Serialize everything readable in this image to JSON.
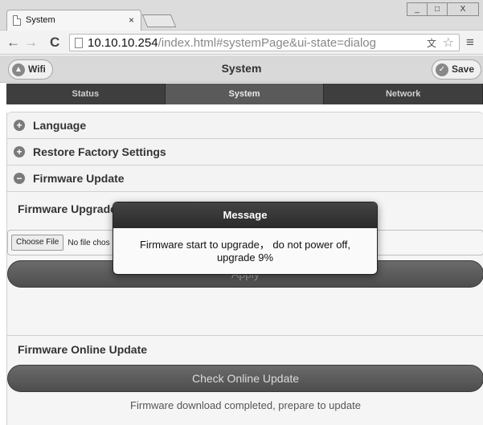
{
  "browser": {
    "tab_title": "System",
    "tab_close": "×",
    "url_host": "10.10.10.254",
    "url_path": "/index.html#systemPage&ui-state=dialog",
    "window_buttons": [
      "_",
      "□",
      "X"
    ],
    "icons": [
      "back-arrow-icon",
      "forward-arrow-icon",
      "reload-icon",
      "page-icon",
      "translate-icon",
      "star-icon",
      "menu-icon"
    ]
  },
  "header": {
    "title": "System",
    "wifi_label": "Wifi",
    "save_label": "Save"
  },
  "nav": {
    "tabs": [
      {
        "label": "Status"
      },
      {
        "label": "System"
      },
      {
        "label": "Network"
      }
    ],
    "active": "System"
  },
  "sections": [
    {
      "label": "Language",
      "state": "collapsed"
    },
    {
      "label": "Restore Factory Settings",
      "state": "collapsed"
    },
    {
      "label": "Firmware Update",
      "state": "expanded"
    }
  ],
  "firmware": {
    "upgrade_label": "Firmware Upgrade",
    "choose_file_label": "Choose File",
    "file_status": "No file chos",
    "apply_label": "Apply",
    "online_update_label": "Firmware Online Update",
    "check_online_label": "Check Online Update",
    "status_text": "Firmware download completed, prepare to update"
  },
  "dialog": {
    "title": "Message",
    "line1": "Firmware start to upgrade， do not power off,",
    "line2": "upgrade 9%"
  },
  "colors": {
    "nav_bg": "#3e3e3e",
    "nav_active": "#5a5a5a",
    "dialog_header": "#333333",
    "button_bg": "#5c5c5c"
  }
}
